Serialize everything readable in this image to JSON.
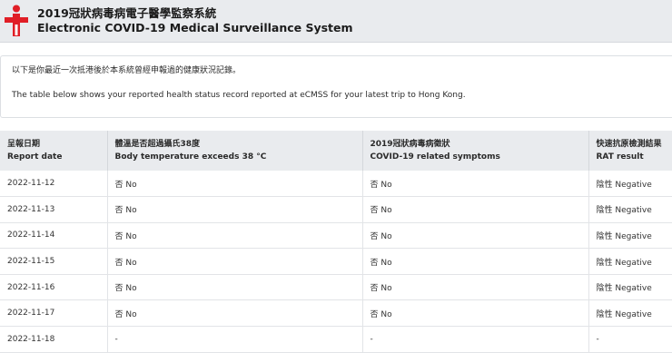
{
  "header": {
    "title_zh": "2019冠狀病毒病電子醫學監察系統",
    "title_en": "Electronic COVID-19 Medical Surveillance System"
  },
  "notice": {
    "line_zh": "以下是你最近一次抵港後於本系統曾經申報過的健康狀況記錄。",
    "line_en": "The table below shows your reported health status record reported at eCMSS for your latest trip to Hong Kong."
  },
  "table": {
    "headers": [
      {
        "zh": "呈報日期",
        "en": "Report date"
      },
      {
        "zh": "體溫是否超過攝氏38度",
        "en": "Body temperature exceeds 38 °C"
      },
      {
        "zh": "2019冠狀病毒病徵狀",
        "en": "COVID-19 related symptoms"
      },
      {
        "zh": "快速抗原檢測結果",
        "en": "RAT result"
      }
    ],
    "rows": [
      {
        "date": "2022-11-12",
        "temp": "否 No",
        "symptoms": "否 No",
        "rat": "陰性 Negative"
      },
      {
        "date": "2022-11-13",
        "temp": "否 No",
        "symptoms": "否 No",
        "rat": "陰性 Negative"
      },
      {
        "date": "2022-11-14",
        "temp": "否 No",
        "symptoms": "否 No",
        "rat": "陰性 Negative"
      },
      {
        "date": "2022-11-15",
        "temp": "否 No",
        "symptoms": "否 No",
        "rat": "陰性 Negative"
      },
      {
        "date": "2022-11-16",
        "temp": "否 No",
        "symptoms": "否 No",
        "rat": "陰性 Negative"
      },
      {
        "date": "2022-11-17",
        "temp": "否 No",
        "symptoms": "否 No",
        "rat": "陰性 Negative"
      },
      {
        "date": "2022-11-18",
        "temp": "-",
        "symptoms": "-",
        "rat": "-"
      }
    ]
  },
  "colors": {
    "logo_red": "#e01e26",
    "header_bg": "#e9ebee"
  }
}
